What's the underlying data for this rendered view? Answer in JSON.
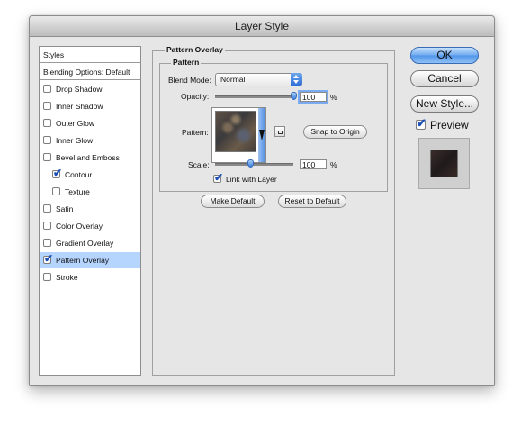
{
  "window": {
    "title": "Layer Style"
  },
  "styles_panel": {
    "header": "Styles",
    "blending_options": "Blending Options: Default",
    "items": [
      {
        "label": "Drop Shadow",
        "checked": false,
        "selected": false
      },
      {
        "label": "Inner Shadow",
        "checked": false,
        "selected": false
      },
      {
        "label": "Outer Glow",
        "checked": false,
        "selected": false
      },
      {
        "label": "Inner Glow",
        "checked": false,
        "selected": false
      },
      {
        "label": "Bevel and Emboss",
        "checked": false,
        "selected": false
      },
      {
        "label": "Contour",
        "checked": true,
        "selected": false,
        "indent": true
      },
      {
        "label": "Texture",
        "checked": false,
        "selected": false,
        "indent": true
      },
      {
        "label": "Satin",
        "checked": false,
        "selected": false
      },
      {
        "label": "Color Overlay",
        "checked": false,
        "selected": false
      },
      {
        "label": "Gradient Overlay",
        "checked": false,
        "selected": false
      },
      {
        "label": "Pattern Overlay",
        "checked": true,
        "selected": true
      },
      {
        "label": "Stroke",
        "checked": false,
        "selected": false
      }
    ]
  },
  "pattern_overlay": {
    "section_title": "Pattern Overlay",
    "group_title": "Pattern",
    "blend_mode_label": "Blend Mode:",
    "blend_mode_value": "Normal",
    "opacity_label": "Opacity:",
    "opacity_value": "100",
    "opacity_fraction": 1.0,
    "opacity_unit": "%",
    "pattern_label": "Pattern:",
    "snap_to_origin": "Snap to Origin",
    "scale_label": "Scale:",
    "scale_value": "100",
    "scale_fraction": 0.45,
    "scale_unit": "%",
    "link_with_layer_label": "Link with Layer",
    "link_with_layer_checked": true,
    "make_default": "Make Default",
    "reset_to_default": "Reset to Default"
  },
  "side_buttons": {
    "ok": "OK",
    "cancel": "Cancel",
    "new_style": "New Style...",
    "preview_label": "Preview",
    "preview_checked": true
  },
  "colors": {
    "selection": "#b5d5ff",
    "accent_blue": "#3c7fe0",
    "dialog_bg": "#e6e6e6"
  }
}
